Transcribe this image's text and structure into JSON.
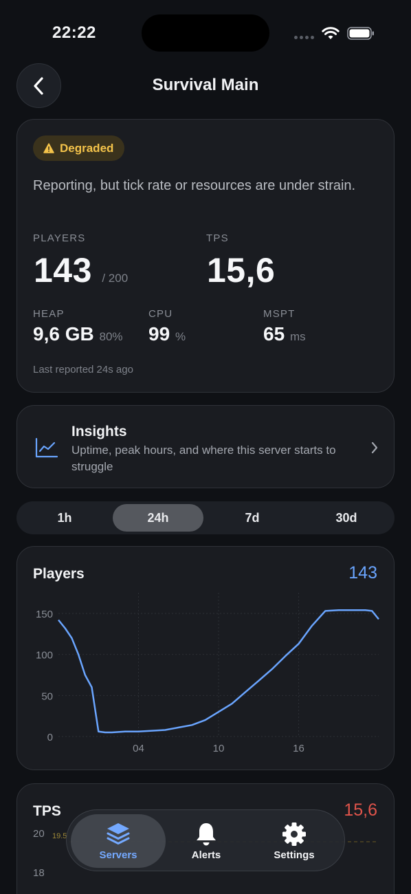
{
  "status_bar": {
    "time": "22:22"
  },
  "nav": {
    "title": "Survival Main"
  },
  "status": {
    "badge": "Degraded",
    "description": "Reporting, but tick rate or resources are under strain.",
    "players_label": "PLAYERS",
    "players_value": "143",
    "players_max": "/ 200",
    "tps_label": "TPS",
    "tps_value": "15,6",
    "heap_label": "HEAP",
    "heap_value": "9,6 GB",
    "heap_pct": "80%",
    "cpu_label": "CPU",
    "cpu_value": "99",
    "cpu_unit": "%",
    "mspt_label": "MSPT",
    "mspt_value": "65",
    "mspt_unit": "ms",
    "last_reported": "Last reported 24s ago"
  },
  "insights": {
    "title": "Insights",
    "description": "Uptime, peak hours, and where this server starts to struggle"
  },
  "range": {
    "options": [
      "1h",
      "24h",
      "7d",
      "30d"
    ],
    "selected": "24h"
  },
  "players_chart": {
    "title": "Players",
    "current": "143",
    "colors": {
      "line": "#6aa5ff"
    }
  },
  "chart_data": [
    {
      "type": "line",
      "title": "Players",
      "x_ticks": [
        "04",
        "10",
        "16"
      ],
      "y_ticks": [
        "0",
        "50",
        "100",
        "150"
      ],
      "ylim": [
        0,
        150
      ],
      "xlim": [
        -2,
        22
      ],
      "grid": true,
      "series": [
        {
          "x": [
            -2,
            -1.5,
            -1,
            -0.5,
            0,
            0.5,
            1,
            1.5,
            2,
            3,
            4,
            5,
            6,
            7,
            8,
            9,
            10,
            11,
            12,
            13,
            14,
            15,
            16,
            17,
            18,
            19,
            20,
            21,
            21.5,
            22
          ],
          "values": [
            142,
            132,
            120,
            100,
            75,
            60,
            6,
            5,
            5,
            6,
            6,
            7,
            8,
            11,
            14,
            20,
            30,
            40,
            54,
            68,
            82,
            98,
            113,
            135,
            153,
            154,
            154,
            154,
            153,
            143
          ]
        }
      ]
    },
    {
      "type": "line",
      "title": "TPS",
      "y_ticks": [
        "20",
        "18"
      ],
      "reference_label": "19.5"
    }
  ],
  "tps_chart": {
    "title": "TPS",
    "current": "15,6"
  },
  "tabbar": {
    "servers": "Servers",
    "alerts": "Alerts",
    "settings": "Settings"
  }
}
